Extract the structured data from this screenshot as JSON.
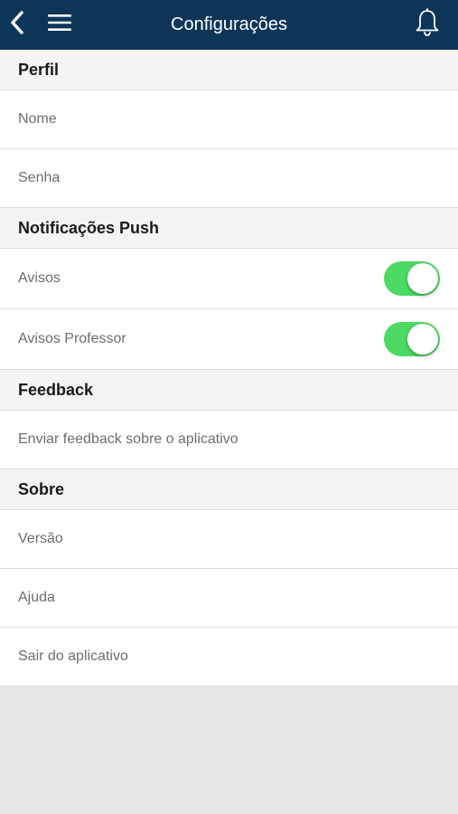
{
  "header": {
    "title": "Configurações",
    "back_icon": "chevron-left-icon",
    "menu_icon": "hamburger-menu-icon",
    "bell_icon": "bell-icon",
    "background_color": "#0d3558"
  },
  "sections": {
    "perfil": {
      "title": "Perfil",
      "items": [
        "Nome",
        "Senha"
      ]
    },
    "notificacoes": {
      "title": "Notificações Push",
      "items": [
        {
          "label": "Avisos",
          "enabled": true
        },
        {
          "label": "Avisos Professor",
          "enabled": true
        }
      ]
    },
    "feedback": {
      "title": "Feedback",
      "items": [
        "Enviar feedback sobre o aplicativo"
      ]
    },
    "sobre": {
      "title": "Sobre",
      "items": [
        "Versão",
        "Ajuda",
        "Sair do aplicativo"
      ]
    }
  },
  "colors": {
    "toggle_on": "#4cd964",
    "toggle_off": "#e5e5e5"
  }
}
